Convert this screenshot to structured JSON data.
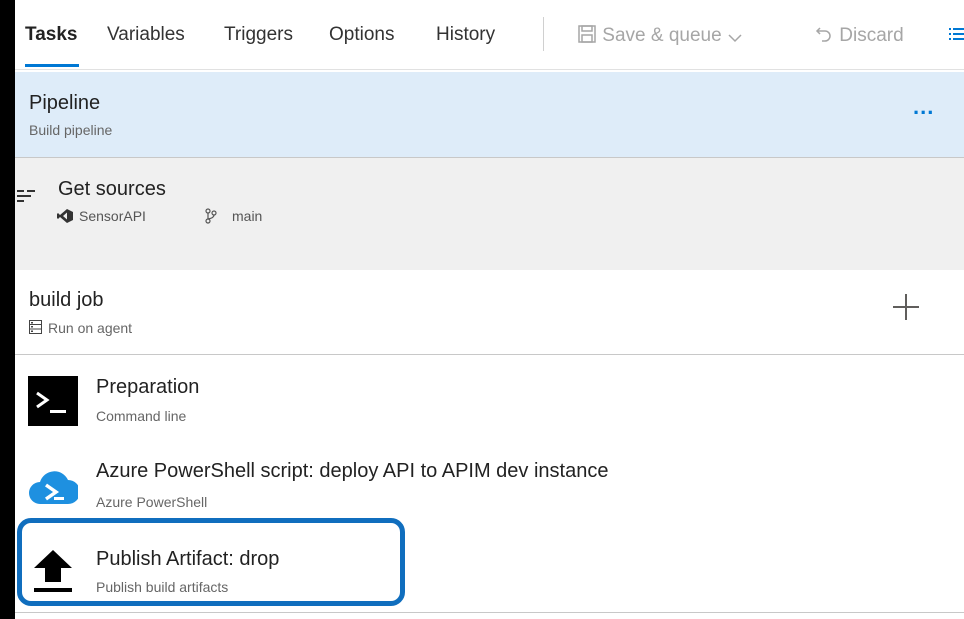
{
  "tabs": [
    {
      "label": "Tasks",
      "active": true
    },
    {
      "label": "Variables"
    },
    {
      "label": "Triggers"
    },
    {
      "label": "Options"
    },
    {
      "label": "History"
    }
  ],
  "toolbar": {
    "save_queue_label": "Save & queue",
    "discard_label": "Discard"
  },
  "pipeline": {
    "title": "Pipeline",
    "subtitle": "Build pipeline",
    "more_label": "..."
  },
  "get_sources": {
    "title": "Get sources",
    "repo": "SensorAPI",
    "branch": "main"
  },
  "job": {
    "title": "build job",
    "subtitle": "Run on agent"
  },
  "tasks": [
    {
      "title": "Preparation",
      "subtitle": "Command line"
    },
    {
      "title": "Azure PowerShell script: deploy API to APIM dev instance",
      "subtitle": "Azure PowerShell"
    },
    {
      "title": "Publish Artifact: drop",
      "subtitle": "Publish build artifacts"
    }
  ],
  "colors": {
    "accent": "#0078d4",
    "pipeline_bg": "#deecf9",
    "sources_bg": "#f0f0f0",
    "highlight": "#106ebe"
  }
}
